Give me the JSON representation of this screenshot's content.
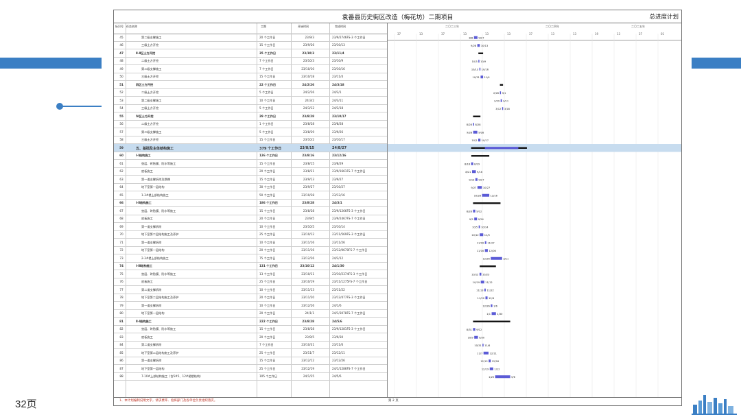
{
  "slide": {
    "page_label": "32页"
  },
  "document": {
    "title": "袁番县历史街区改造（梅花坊）二期项目",
    "right_label": "总进度计划",
    "footer_note": "1、本计划编制说明文字，请求费率、指挥部门及各单位负责组织落实。",
    "footer_page": "第 2 页"
  },
  "table": {
    "headers": {
      "id": "标识号",
      "name": "任务名称",
      "dur": "工期",
      "start": "开始时间",
      "end": "完成时间"
    }
  },
  "gantt": {
    "years": [
      "二〇二三年",
      "二〇二四年",
      "二〇二五年"
    ],
    "ticks": [
      "37",
      "13",
      "37",
      "13",
      "13",
      "13",
      "37",
      "13",
      "13",
      "19",
      "13",
      "37",
      "01"
    ]
  },
  "rows": [
    {
      "id": "45",
      "name": "第二级支撑施工",
      "dur": "20 个工作日",
      "start": "23/9/3",
      "end": "23/9/27",
      "extra": "46FS-3 个工作日",
      "bar": "8/8 9/27",
      "type": "task"
    },
    {
      "id": "46",
      "name": "三级土方开挖",
      "dur": "15 个工作日",
      "start": "23/9/26",
      "end": "23/10/13",
      "extra": "",
      "bar": "9/28 10/13",
      "type": "task"
    },
    {
      "id": "47",
      "name": "Ⅱ-Ⅱ区土方开挖",
      "dur": "35 个工作日",
      "start": "23/10/3",
      "end": "23/11/4",
      "extra": "",
      "bar": "",
      "type": "summary"
    },
    {
      "id": "48",
      "name": "二级土方开挖",
      "dur": "7 个工作日",
      "start": "23/10/3",
      "end": "23/10/9",
      "extra": "",
      "bar": "10/3 10/9",
      "type": "task"
    },
    {
      "id": "49",
      "name": "第二级支撑施工",
      "dur": "7 个工作日",
      "start": "23/10/10",
      "end": "23/10/16",
      "extra": "",
      "bar": "10/13 10/16",
      "type": "task"
    },
    {
      "id": "50",
      "name": "三级土方开挖",
      "dur": "15 个工作日",
      "start": "23/10/18",
      "end": "23/11/4",
      "extra": "",
      "bar": "10/31 11/4",
      "type": "task"
    },
    {
      "id": "51",
      "name": "四区土方开挖",
      "dur": "22 个工作日",
      "start": "24/2/26",
      "end": "24/3/18",
      "extra": "",
      "bar": "",
      "type": "summary"
    },
    {
      "id": "52",
      "name": "二级土方开挖",
      "dur": "5 个工作日",
      "start": "24/2/26",
      "end": "24/3/1",
      "extra": "",
      "bar": "2/26 3/1",
      "type": "task"
    },
    {
      "id": "53",
      "name": "第二级支撑施工",
      "dur": "10 个工作日",
      "start": "24/3/2",
      "end": "24/3/11",
      "extra": "",
      "bar": "2/29 3/11",
      "type": "task"
    },
    {
      "id": "54",
      "name": "三级土方开挖",
      "dur": "5 个工作日",
      "start": "24/3/12",
      "end": "24/3/18",
      "extra": "",
      "bar": "3/12 3/18",
      "type": "task"
    },
    {
      "id": "55",
      "name": "Ⅳ区土方开挖",
      "dur": "29 个工作日",
      "start": "23/8/28",
      "end": "23/10/17",
      "extra": "",
      "bar": "",
      "type": "summary"
    },
    {
      "id": "56",
      "name": "二级土方开挖",
      "dur": "1 个工作日",
      "start": "23/8/28",
      "end": "23/8/28",
      "extra": "",
      "bar": "8/28 8/28",
      "type": "task"
    },
    {
      "id": "57",
      "name": "第二级支撑施工",
      "dur": "5 个工作日",
      "start": "23/8/29",
      "end": "23/9/26",
      "extra": "",
      "bar": "9/28 9/28",
      "type": "task"
    },
    {
      "id": "58",
      "name": "三级土方开挖",
      "dur": "15 个工作日",
      "start": "23/10/2",
      "end": "23/10/17",
      "extra": "",
      "bar": "10/2 10/17",
      "type": "task"
    },
    {
      "id": "59",
      "name": "五、基础及主体结构施工",
      "dur": "379 个工作日",
      "start": "23/8/15",
      "end": "24/8/27",
      "extra": "",
      "bar": "",
      "type": "highlight"
    },
    {
      "id": "60",
      "name": "Ⅰ-Ⅰ结构施工",
      "dur": "126 个工作日",
      "start": "23/8/16",
      "end": "23/12/16",
      "extra": "",
      "bar": "",
      "type": "summary"
    },
    {
      "id": "61",
      "name": "垫层、砖胎膜、防水等施工",
      "dur": "15 个工作日",
      "start": "23/8/15",
      "end": "23/8/29",
      "extra": "",
      "bar": "8/16 8/29",
      "type": "task"
    },
    {
      "id": "62",
      "name": "底板施工",
      "dur": "20 个工作日",
      "start": "23/8/21",
      "end": "23/9/16",
      "extra": "61FS-7 个工作日",
      "bar": "8/21 9/16",
      "type": "task"
    },
    {
      "id": "63",
      "name": "第一道支撑拆除及换撑",
      "dur": "15 个工作日",
      "start": "23/9/13",
      "end": "23/9/27",
      "extra": "",
      "bar": "9/13 9/27",
      "type": "task"
    },
    {
      "id": "64",
      "name": "地下室第一层结构",
      "dur": "30 个工作日",
      "start": "23/9/27",
      "end": "23/10/27",
      "extra": "",
      "bar": "9/27 10/27",
      "type": "task"
    },
    {
      "id": "65",
      "name": "1-3#楼上部结构施工",
      "dur": "50 个工作日",
      "start": "23/10/28",
      "end": "23/12/16",
      "extra": "",
      "bar": "10/28 12/16",
      "type": "task"
    },
    {
      "id": "66",
      "name": "Ⅰ-Ⅱ结构施工",
      "dur": "186 个工作日",
      "start": "23/8/28",
      "end": "24/3/1",
      "extra": "",
      "bar": "",
      "type": "summary"
    },
    {
      "id": "67",
      "name": "垫层、砖胎膜、防水等施工",
      "dur": "15 个工作日",
      "start": "23/8/28",
      "end": "23/9/12",
      "extra": "66FS-3 个工作日",
      "bar": "8/28 9/12",
      "type": "task"
    },
    {
      "id": "68",
      "name": "底板施工",
      "dur": "20 个工作日",
      "start": "23/9/5",
      "end": "23/9/24",
      "extra": "67FS-7 个工作日",
      "bar": "9/5 9/24",
      "type": "task"
    },
    {
      "id": "69",
      "name": "第一道支撑拆除",
      "dur": "10 个工作日",
      "start": "23/10/5",
      "end": "23/10/14",
      "extra": "",
      "bar": "10/5 10/14",
      "type": "task"
    },
    {
      "id": "70",
      "name": "地下室第二层结构施工及养护",
      "dur": "25 个工作日",
      "start": "23/10/12",
      "end": "23/11/5",
      "extra": "69FS-3 个工作日",
      "bar": "10/12 11/5",
      "type": "task"
    },
    {
      "id": "71",
      "name": "第一道支撑拆除",
      "dur": "10 个工作日",
      "start": "23/11/16",
      "end": "23/11/26",
      "extra": "",
      "bar": "11/16 11/27",
      "type": "task"
    },
    {
      "id": "72",
      "name": "地下室第一层结构",
      "dur": "20 个工作日",
      "start": "23/11/16",
      "end": "23/12/06",
      "extra": "70FS-7 个工作日",
      "bar": "11/16 12/06",
      "type": "task"
    },
    {
      "id": "73",
      "name": "2-3#楼上部结构施工",
      "dur": "75 个工作日",
      "start": "23/12/26",
      "end": "24/3/12",
      "extra": "",
      "bar": "12/26 3/11",
      "type": "task"
    },
    {
      "id": "74",
      "name": "Ⅰ-Ⅲ结构施工",
      "dur": "131 个工作日",
      "start": "23/10/12",
      "end": "24/1/30",
      "extra": "",
      "bar": "",
      "type": "summary"
    },
    {
      "id": "75",
      "name": "垫层、砖胎膜、防水等施工",
      "dur": "13 个工作日",
      "start": "23/10/11",
      "end": "23/10/23",
      "extra": "74FS-3 个工作日",
      "bar": "10/12 10/23",
      "type": "task"
    },
    {
      "id": "76",
      "name": "底板施工",
      "dur": "25 个工作日",
      "start": "23/10/19",
      "end": "23/11/12",
      "extra": "75FS-7 个工作日",
      "bar": "10/19 11/12",
      "type": "task"
    },
    {
      "id": "77",
      "name": "第二道支撑拆除",
      "dur": "10 个工作日",
      "start": "23/11/13",
      "end": "23/11/22",
      "extra": "",
      "bar": "11/13 11/22",
      "type": "task"
    },
    {
      "id": "78",
      "name": "地下室第二层结构施工及养护",
      "dur": "20 个工作日",
      "start": "23/11/20",
      "end": "23/12/4",
      "extra": "77FS-3 个工作日",
      "bar": "11/20 12/4",
      "type": "task"
    },
    {
      "id": "79",
      "name": "第一道支撑拆除",
      "dur": "10 个工作日",
      "start": "23/12/26",
      "end": "24/1/6",
      "extra": "",
      "bar": "12/26 1/6",
      "type": "task"
    },
    {
      "id": "80",
      "name": "地下室第一层结构",
      "dur": "20 个工作日",
      "start": "24/1/1",
      "end": "24/1/30",
      "extra": "78FS-7 个工作日",
      "bar": "1/1 1/30",
      "type": "task"
    },
    {
      "id": "81",
      "name": "Ⅱ-Ⅰ结构施工",
      "dur": "222 个工作日",
      "start": "23/8/28",
      "end": "24/5/6",
      "extra": "",
      "bar": "",
      "type": "summary"
    },
    {
      "id": "82",
      "name": "垫层、砖胎膜、防水等施工",
      "dur": "15 个工作日",
      "start": "23/8/28",
      "end": "23/9/12",
      "extra": "81FS-3 个工作日",
      "bar": "8/31 9/12",
      "type": "task"
    },
    {
      "id": "83",
      "name": "底板施工",
      "dur": "20 个工作日",
      "start": "23/9/5",
      "end": "23/9/30",
      "extra": "",
      "bar": "10/9 9/30",
      "type": "task"
    },
    {
      "id": "84",
      "name": "第二道支撑拆除",
      "dur": "7 个工作日",
      "start": "23/10/31",
      "end": "23/11/6",
      "extra": "",
      "bar": "10/31 11/6",
      "type": "task"
    },
    {
      "id": "85",
      "name": "地下室第二层结构施工及养护",
      "dur": "25 个工作日",
      "start": "23/11/7",
      "end": "23/12/11",
      "extra": "",
      "bar": "11/7 12/11",
      "type": "task"
    },
    {
      "id": "86",
      "name": "第一道支撑拆除",
      "dur": "15 个工作日",
      "start": "23/12/12",
      "end": "23/12/26",
      "extra": "",
      "bar": "12/12 12/26",
      "type": "task"
    },
    {
      "id": "87",
      "name": "地下室第一层结构",
      "dur": "25 个工作日",
      "start": "23/12/19",
      "end": "24/1/12",
      "extra": "86FS-7 个工作日",
      "bar": "12/19 1/12",
      "type": "task"
    },
    {
      "id": "88",
      "name": "7-10#上部结构施工（含5#5、12#裙楼结构）",
      "dur": "105 个工作日",
      "start": "24/1/25",
      "end": "24/5/6",
      "extra": "",
      "bar": "1/25 5/6",
      "type": "task"
    }
  ],
  "colors": {
    "accent": "#3b7fc4",
    "bar": "#5b5bd6",
    "highlight_row": "#c7dcef",
    "summary_bar": "#111111"
  }
}
